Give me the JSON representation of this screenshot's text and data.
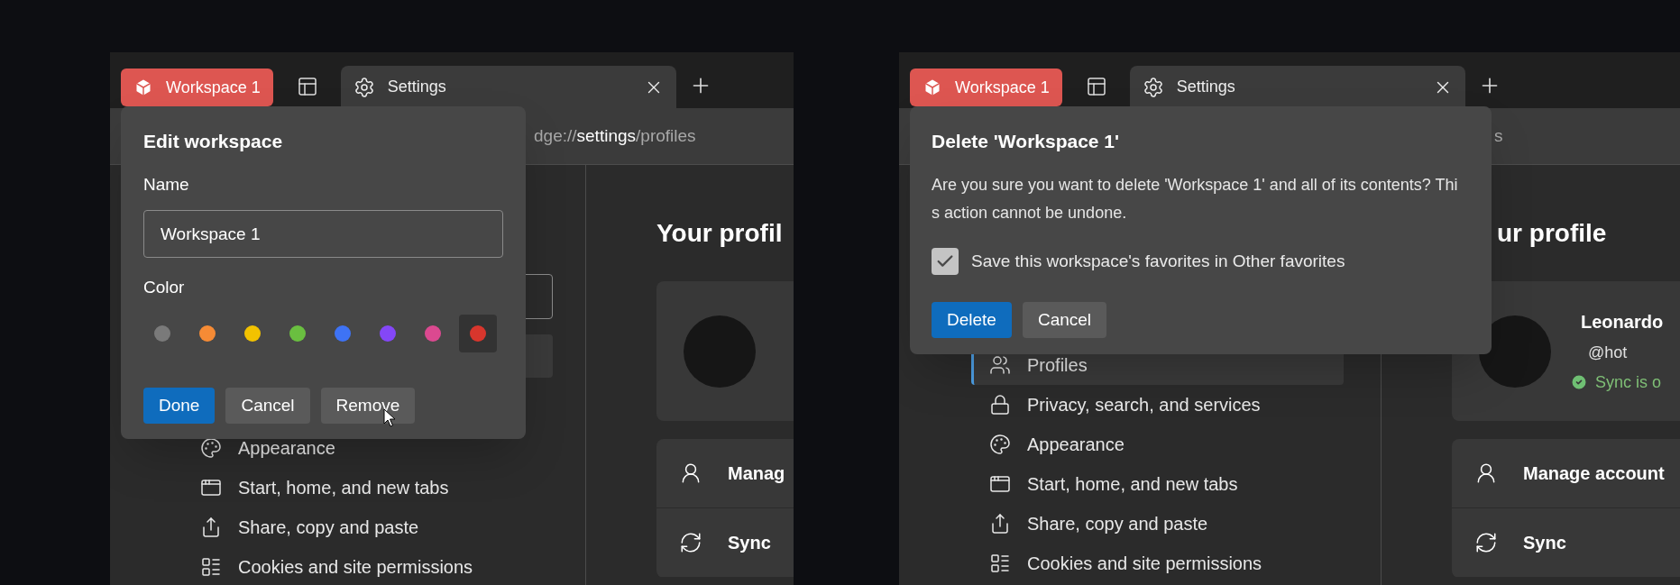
{
  "windows": [
    {
      "workspace_tab": {
        "label": "Workspace 1",
        "color": "#dd5651"
      },
      "tabs": [
        {
          "label": "Settings",
          "selected": true
        }
      ],
      "address": {
        "scheme": "dge://",
        "page": "settings",
        "path": "/profiles"
      },
      "sidebar": {
        "items": [
          {
            "label": "Appearance",
            "selected": false
          },
          {
            "label": "Start, home, and new tabs",
            "selected": false
          },
          {
            "label": "Share, copy and paste",
            "selected": false
          },
          {
            "label": "Cookies and site permissions",
            "selected": false
          }
        ]
      },
      "main": {
        "heading": "Your profil",
        "menu": [
          {
            "label": "Manag"
          },
          {
            "label": "Sync"
          }
        ]
      },
      "dialog": {
        "kind": "edit",
        "title": "Edit workspace",
        "name_label": "Name",
        "name_value": "Workspace 1",
        "color_label": "Color",
        "colors": [
          {
            "color": "#7a7a7a",
            "selected": false
          },
          {
            "color": "#f68b35",
            "selected": false
          },
          {
            "color": "#f2c200",
            "selected": false
          },
          {
            "color": "#6abf40",
            "selected": false
          },
          {
            "color": "#3e73f5",
            "selected": false
          },
          {
            "color": "#8447f7",
            "selected": false
          },
          {
            "color": "#db4990",
            "selected": false
          },
          {
            "color": "#d8362d",
            "selected": true
          }
        ],
        "buttons": [
          {
            "label": "Done",
            "primary": true
          },
          {
            "label": "Cancel",
            "primary": false
          },
          {
            "label": "Remove",
            "primary": false
          }
        ]
      }
    },
    {
      "workspace_tab": {
        "label": "Workspace 1",
        "color": "#dd5651"
      },
      "tabs": [
        {
          "label": "Settings",
          "selected": true
        }
      ],
      "address": {
        "path": "s"
      },
      "sidebar": {
        "items": [
          {
            "label": "Profiles",
            "selected": true
          },
          {
            "label": "Privacy, search, and services",
            "selected": false
          },
          {
            "label": "Appearance",
            "selected": false
          },
          {
            "label": "Start, home, and new tabs",
            "selected": false
          },
          {
            "label": "Share, copy and paste",
            "selected": false
          },
          {
            "label": "Cookies and site permissions",
            "selected": false
          }
        ]
      },
      "main": {
        "heading": "ur profile",
        "profile": {
          "name": "Leonardo",
          "email": "@hot",
          "status": "Sync is o"
        },
        "menu": [
          {
            "label": "Manage account"
          },
          {
            "label": "Sync"
          }
        ]
      },
      "dialog": {
        "kind": "delete",
        "title": "Delete 'Workspace 1'",
        "message": "Are you sure you want to delete 'Workspace 1' and all of its contents? This action cannot be undone.",
        "checkbox": {
          "label": "Save this workspace's favorites in Other favorites",
          "checked": true
        },
        "buttons": [
          {
            "label": "Delete",
            "primary": true
          },
          {
            "label": "Cancel",
            "primary": false
          }
        ]
      }
    }
  ]
}
